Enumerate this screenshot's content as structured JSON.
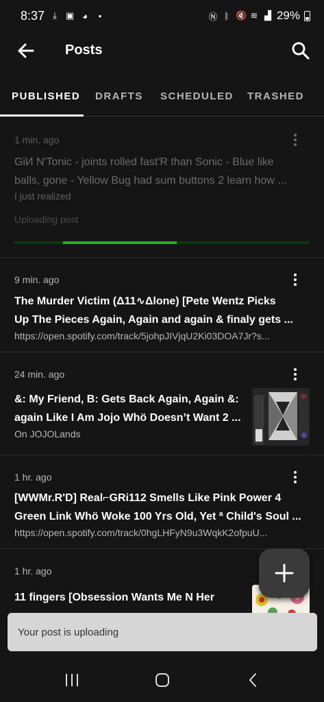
{
  "status_bar": {
    "time": "8:37",
    "battery": "29%",
    "icons": [
      "download-icon",
      "image-icon",
      "messenger-icon",
      "dot-icon",
      "nfc-icon",
      "bluetooth-icon",
      "mute-icon",
      "wifi-icon",
      "signal-icon",
      "battery-icon"
    ]
  },
  "app_bar": {
    "title": "Posts"
  },
  "tabs": [
    {
      "label": "PUBLISHED",
      "active": true
    },
    {
      "label": "DRAFTS",
      "active": false
    },
    {
      "label": "SCHEDULED",
      "active": false
    },
    {
      "label": "TRASHED",
      "active": false
    }
  ],
  "posts": [
    {
      "time": "1 min. ago",
      "title_line1": "GiИ N'Tonic - joints rolled fast'R than Sonic - Blue like",
      "title_line2": "balls, gone - Yellow Bug had sum buttons 2 learn how ...",
      "subtitle": "I just realized",
      "status": "Uploading post",
      "progress": 0.55
    },
    {
      "time": "9 min. ago",
      "title_line1": "The Murder Victim (Δ11∿Δlone) [Pete Wentz Picks",
      "title_line2": "Up The Pieces Again,  Again  and  again & finaly gets ...",
      "subtitle": "https://open.spotify.com/track/5johpJIVjqU2Ki03DOA7Jr?s..."
    },
    {
      "time": "24 min. ago",
      "title_line1": "&: My Friend, B: Gets Back Again, Again &:",
      "title_line2": "again Like I Am Jojo Whö Doesn’t Want 2 ...",
      "subtitle": "On JOJOLands"
    },
    {
      "time": "1 hr. ago",
      "title_line1": "[WWMr.R'D] Real⌐GRi112 Smells Like Pink Power 4",
      "title_line2": "Green Link Whö Woke 100 Yrs Old, Yet ª Child's Soul ...",
      "subtitle": "https://open.spotify.com/track/0hgLHFyN9u3WqkK2ofpuU..."
    },
    {
      "time": "1 hr. ago",
      "title_line1": "11 fingers [Obsession Wants Me N Her"
    }
  ],
  "snackbar": {
    "message": "Your post is uploading"
  },
  "colors": {
    "background": "#151515",
    "accent_green": "#1db41d",
    "snackbar": "#d6d6d6"
  }
}
